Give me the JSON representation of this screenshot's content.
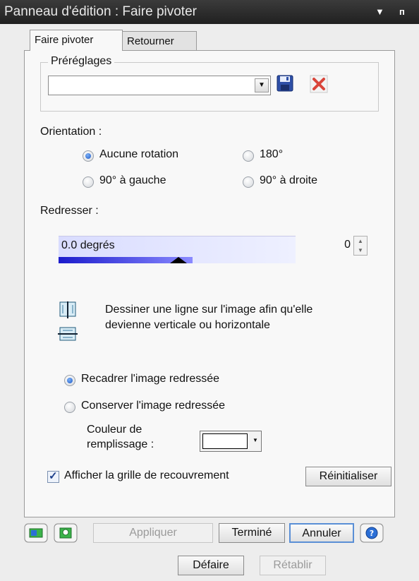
{
  "titlebar": {
    "title": "Panneau d'édition : Faire pivoter",
    "menu_glyph": "▼",
    "pin_glyph": "ᴨ"
  },
  "tabs": [
    {
      "label": "Faire pivoter",
      "active": true
    },
    {
      "label": "Retourner",
      "active": false
    }
  ],
  "presets": {
    "legend": "Préréglages",
    "value": "",
    "icons": [
      "save-icon",
      "delete-icon"
    ]
  },
  "orientation": {
    "label": "Orientation :",
    "options": [
      {
        "label": "Aucune rotation",
        "checked": true
      },
      {
        "label": "180°",
        "checked": false
      },
      {
        "label": "90° à gauche",
        "checked": false
      },
      {
        "label": "90° à droite",
        "checked": false
      }
    ]
  },
  "straighten": {
    "label": "Redresser :",
    "slider_text": "0.0 degrés",
    "spin_value": "0"
  },
  "draw_line": {
    "text_line1": "Dessiner une ligne sur l'image afin qu'elle",
    "text_line2": "devienne verticale ou horizontale",
    "icons": [
      "vertical-line-tool-icon",
      "horizontal-line-tool-icon"
    ]
  },
  "crop_options": [
    {
      "label": "Recadrer l'image redressée",
      "checked": true
    },
    {
      "label": "Conserver l'image redressée",
      "checked": false
    }
  ],
  "fill": {
    "label_line1": "Couleur de",
    "label_line2": "remplissage :",
    "color": "#ffffff"
  },
  "grid": {
    "label": "Afficher la grille de recouvrement",
    "checked": true
  },
  "buttons": {
    "reset": "Réinitialiser",
    "apply": "Appliquer",
    "done": "Terminé",
    "cancel": "Annuler",
    "undo": "Défaire",
    "redo": "Rétablir"
  },
  "bottom_icons": [
    "image-toggle-icon",
    "compare-icon",
    "help-icon"
  ],
  "colors": {
    "accent": "#1b58c8",
    "slider": "#1c1ccc"
  }
}
